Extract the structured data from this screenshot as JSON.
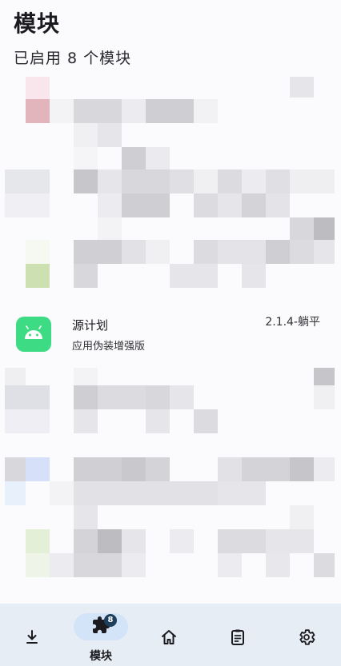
{
  "header": {
    "title": "模块",
    "subtitle": "已启用 8 个模块"
  },
  "module": {
    "name": "源计划",
    "description": "应用伪装增强版",
    "version": "2.1.4-躺平",
    "icon": "android-icon",
    "icon_color": "#3ddc84"
  },
  "nav": {
    "items": [
      {
        "name": "download-icon",
        "label": ""
      },
      {
        "name": "modules-icon",
        "label": "模块",
        "badge": "8",
        "active": true
      },
      {
        "name": "home-icon",
        "label": ""
      },
      {
        "name": "logs-icon",
        "label": ""
      },
      {
        "name": "settings-icon",
        "label": ""
      }
    ],
    "accent": "#d3e3f8",
    "bar_color": "#e7edf5"
  }
}
